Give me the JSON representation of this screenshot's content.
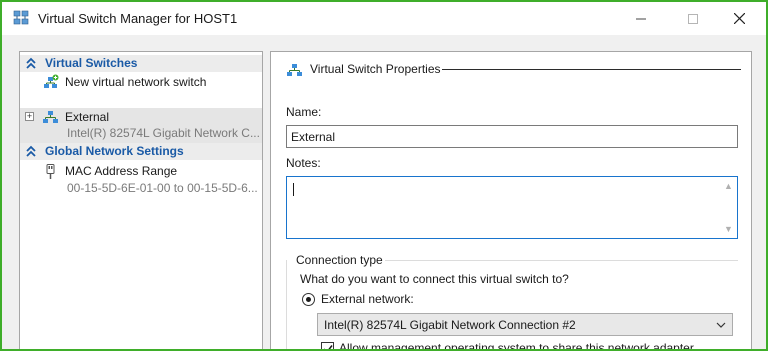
{
  "window": {
    "title": "Virtual Switch Manager for HOST1"
  },
  "colors": {
    "accent_border": "#3fae2a",
    "section_header_text": "#1a5aa6",
    "focus_border": "#1874cd"
  },
  "left_pane": {
    "sections": [
      {
        "label": "Virtual Switches",
        "icon": "chevron-double-up-icon",
        "items": [
          {
            "label": "New virtual network switch",
            "icon": "new-switch-icon"
          },
          {
            "label": "External",
            "sublabel": "Intel(R) 82574L Gigabit Network C...",
            "icon": "network-switch-icon",
            "expander": "+"
          }
        ]
      },
      {
        "label": "Global Network Settings",
        "icon": "chevron-double-up-icon",
        "items": [
          {
            "label": "MAC Address Range",
            "sublabel": "00-15-5D-6E-01-00 to 00-15-5D-6...",
            "icon": "mac-address-icon"
          }
        ]
      }
    ]
  },
  "right_pane": {
    "header": "Virtual Switch Properties",
    "name_label": "Name:",
    "name_value": "External",
    "notes_label": "Notes:",
    "notes_value": "",
    "connection": {
      "group_label": "Connection type",
      "question": "What do you want to connect this virtual switch to?",
      "external_label": "External network:",
      "external_selected": true,
      "adapter_value": "Intel(R) 82574L Gigabit Network Connection #2",
      "share_label": "Allow management operating system to share this network adapter",
      "share_checked": true
    }
  }
}
